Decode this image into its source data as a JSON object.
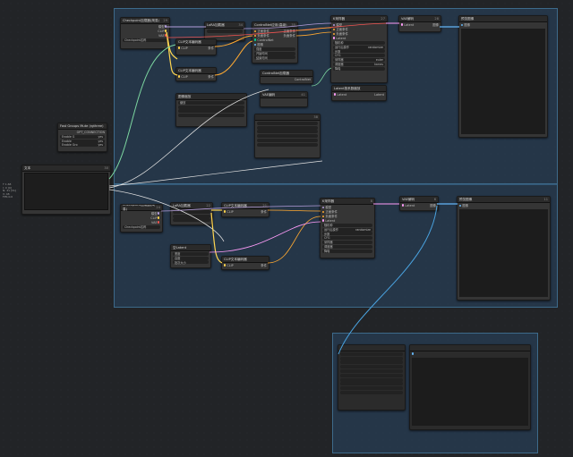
{
  "colors": {
    "group_bg": "#2a4a66",
    "node_bg": "#353535",
    "model_port": "#b39ddb",
    "clip_port": "#ffd54f",
    "vae_port": "#ef5350",
    "cond_port": "#ffa931",
    "latent_port": "#ff9cf9",
    "image_port": "#64b5f6",
    "link_white": "#e0e0e0",
    "link_green": "#7cd6a0",
    "link_blue": "#4aa3e0"
  },
  "side_label": [
    "T 1.68",
    "I: 0 [0]",
    "N: 31 [31]",
    "V: 48",
    "FPS:0.0"
  ],
  "left_nodes": {
    "fast_groups": {
      "title": "Fast Groups Mute (rgthree)",
      "sub": "OPT_CONNECTION",
      "rows": [
        {
          "label": "Enable G",
          "value": "yes"
        },
        {
          "label": "Enable",
          "value": "yes"
        },
        {
          "label": "Enable Gro",
          "value": "yes"
        }
      ]
    },
    "text_node": {
      "title": "文本",
      "id": "30",
      "text": ""
    }
  },
  "group1": {
    "title": "",
    "checkpoint": {
      "title": "Checkpoint加载器(简易)",
      "id": "29",
      "outputs": [
        "模型",
        "CLIP",
        "VAE"
      ],
      "widget_label": "Checkpoint名称",
      "widget_value": ""
    },
    "lora": {
      "title": "LoRA加载器",
      "id": "34",
      "outputs": [
        "模型",
        "CLIP"
      ],
      "widget_value": ""
    },
    "cn_apply": {
      "title": "ControlNet应用(高级)",
      "id": "35",
      "inputs": [
        "正面条件",
        "负面条件",
        "ControlNet",
        "图像"
      ],
      "outputs": [
        "正面条件",
        "负面条件"
      ],
      "rows": [
        {
          "label": "强度",
          "value": ""
        },
        {
          "label": "开始时间",
          "value": ""
        },
        {
          "label": "结束时间",
          "value": ""
        }
      ]
    },
    "ksampler": {
      "title": "K采样器",
      "id": "27",
      "inputs": [
        "模型",
        "正面条件",
        "负面条件",
        "Latent"
      ],
      "rows": [
        {
          "label": "随机种",
          "value": ""
        },
        {
          "label": "运行后操作",
          "value": "randomize"
        },
        {
          "label": "步数",
          "value": ""
        },
        {
          "label": "CFG",
          "value": ""
        },
        {
          "label": "采样器",
          "value": "euler"
        },
        {
          "label": "调度器",
          "value": "karras"
        },
        {
          "label": "降噪",
          "value": ""
        }
      ]
    },
    "vae_decode": {
      "title": "VAE解码",
      "id": "28",
      "inputs": [
        "Latent",
        "VAE"
      ],
      "output": "图像"
    },
    "preview": {
      "title": "预览图像",
      "id": "",
      "input": "图像"
    },
    "clip_pos": {
      "title": "CLIP文本编码器",
      "id": "",
      "input": "CLIP",
      "output": "条件"
    },
    "clip_neg": {
      "title": "CLIP文本编码器",
      "id": "",
      "input": "CLIP",
      "output": "条件"
    },
    "cn_loader": {
      "title": "ControlNet加载器",
      "id": "",
      "output": "ControlNet"
    },
    "img_load": {
      "title": "加载图像",
      "id": "",
      "outputs": [
        "图像",
        "遮罩"
      ],
      "value": ""
    },
    "empty_latent": {
      "title": "空Latent",
      "id": "",
      "output": "Latent"
    },
    "upscale": {
      "title": "Latent按系数缩放",
      "id": "",
      "input": "Latent",
      "output": "Latent"
    },
    "node_41": {
      "title": "VAE编码",
      "id": "41"
    },
    "node_38": {
      "title": "",
      "id": "38",
      "rows": [
        {
          "label": "",
          "value": ""
        },
        {
          "label": "",
          "value": ""
        },
        {
          "label": "",
          "value": ""
        },
        {
          "label": "",
          "value": ""
        },
        {
          "label": "",
          "value": ""
        },
        {
          "label": "",
          "value": ""
        },
        {
          "label": "",
          "value": ""
        }
      ]
    },
    "image_node": {
      "title": "图像缩放",
      "id": "",
      "rows": [
        {
          "label": "缩放",
          "value": ""
        },
        {
          "label": "",
          "value": ""
        },
        {
          "label": "",
          "value": ""
        },
        {
          "label": "",
          "value": ""
        }
      ]
    },
    "prompt_text": ""
  },
  "group2": {
    "title": "",
    "checkpoint": {
      "title": "Checkpoint加载器(简易)",
      "id": "24",
      "outputs": [
        "模型",
        "CLIP",
        "VAE"
      ],
      "widget_label": "Checkpoint名称",
      "widget_value": ""
    },
    "lora": {
      "title": "LoRA加载器",
      "id": "22",
      "rows": [
        {
          "label": "",
          "value": ""
        },
        {
          "label": "",
          "value": ""
        },
        {
          "label": "",
          "value": ""
        }
      ]
    },
    "clip_pos": {
      "title": "CLIP文本编码器",
      "id": "21",
      "input": "CLIP",
      "output": "条件"
    },
    "clip_neg": {
      "title": "CLIP文本编码器",
      "id": "",
      "input": "CLIP",
      "output": "条件"
    },
    "latent": {
      "title": "空Latent",
      "id": "",
      "rows": [
        {
          "label": "宽度",
          "value": ""
        },
        {
          "label": "高度",
          "value": ""
        },
        {
          "label": "批次大小",
          "value": ""
        }
      ]
    },
    "ksampler": {
      "title": "K采样器",
      "id": "8",
      "inputs": [
        "模型",
        "正面条件",
        "负面条件",
        "Latent"
      ],
      "rows": [
        {
          "label": "随机种",
          "value": ""
        },
        {
          "label": "运行后操作",
          "value": "randomize"
        },
        {
          "label": "步数",
          "value": ""
        },
        {
          "label": "CFG",
          "value": ""
        },
        {
          "label": "采样器",
          "value": ""
        },
        {
          "label": "调度器",
          "value": ""
        },
        {
          "label": "降噪",
          "value": ""
        }
      ]
    },
    "vae_decode": {
      "title": "VAE解码",
      "id": "6",
      "inputs": [
        "Latent",
        "VAE"
      ],
      "output": "图像"
    },
    "preview": {
      "title": "预览图像",
      "id": "11",
      "input": "图像"
    },
    "prompt_text": ""
  },
  "group3": {
    "title": "",
    "node_a": {
      "title": "",
      "rows": [
        {
          "label": "",
          "value": ""
        },
        {
          "label": "",
          "value": ""
        },
        {
          "label": "",
          "value": ""
        },
        {
          "label": "",
          "value": ""
        },
        {
          "label": "",
          "value": ""
        },
        {
          "label": "",
          "value": ""
        },
        {
          "label": "",
          "value": ""
        },
        {
          "label": "",
          "value": ""
        },
        {
          "label": "",
          "value": ""
        },
        {
          "label": "",
          "value": ""
        }
      ]
    },
    "node_b": {
      "title": "",
      "label": ""
    }
  }
}
